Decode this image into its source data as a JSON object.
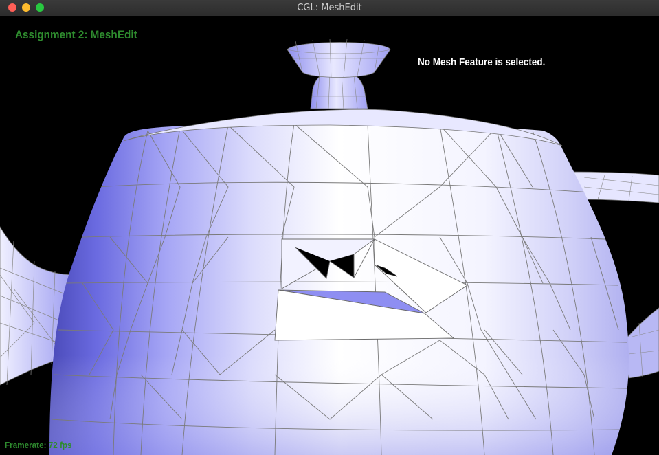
{
  "window": {
    "title": "CGL: MeshEdit",
    "buttons": {
      "close": "close-icon",
      "minimize": "minimize-icon",
      "maximize": "maximize-icon"
    }
  },
  "overlay": {
    "assignment_title": "Assignment 2: MeshEdit",
    "selection_status": "No Mesh Feature is selected.",
    "framerate": "Framerate: 72 fps"
  },
  "colors": {
    "background": "#000000",
    "mesh_light": "#ffffff",
    "mesh_shade": "#7b7bee",
    "wireframe": "#777777",
    "overlay_green": "#2e8b2e",
    "overlay_white": "#ffffff"
  }
}
